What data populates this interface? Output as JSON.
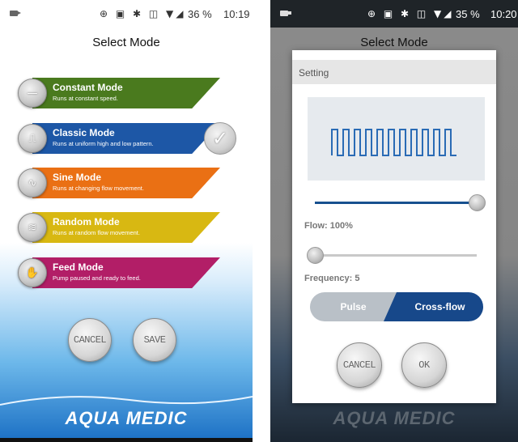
{
  "left_screen": {
    "status": {
      "battery": "36 %",
      "time": "10:19"
    },
    "title": "Select Mode",
    "modes": [
      {
        "name": "Constant Mode",
        "desc": "Runs at constant speed.",
        "color": "#4a7a1e",
        "icon": "flat-line-icon"
      },
      {
        "name": "Classic Mode",
        "desc": "Runs at uniform high and low pattern.",
        "color": "#1d57a6",
        "icon": "square-wave-icon"
      },
      {
        "name": "Sine Mode",
        "desc": "Runs at changing flow movement.",
        "color": "#ea7014",
        "icon": "sine-wave-icon"
      },
      {
        "name": "Random Mode",
        "desc": "Runs at random flow movement.",
        "color": "#d8b812",
        "icon": "random-wave-icon"
      },
      {
        "name": "Feed Mode",
        "desc": "Pump paused and ready to feed.",
        "color": "#b21e67",
        "icon": "feed-hand-icon"
      }
    ],
    "selected_mode": "Classic Mode",
    "buttons": {
      "cancel": "CANCEL",
      "save": "SAVE"
    },
    "logo": "AQUA MEDIC"
  },
  "right_screen": {
    "status": {
      "battery": "35 %",
      "time": "10:20"
    },
    "title": "Select Mode",
    "dialog": {
      "title": "Setting",
      "flow_label": "Flow: 100%",
      "flow_value": 1.0,
      "frequency_label": "Frequency: 5",
      "frequency_value": 0.0,
      "toggle": {
        "option_a": "Pulse",
        "option_b": "Cross-flow",
        "selected": "Cross-flow"
      },
      "buttons": {
        "cancel": "CANCEL",
        "ok": "OK"
      }
    },
    "logo": "AQUA MEDIC"
  },
  "colors": {
    "accent": "#17488a",
    "slider_fill": "#17508f"
  }
}
